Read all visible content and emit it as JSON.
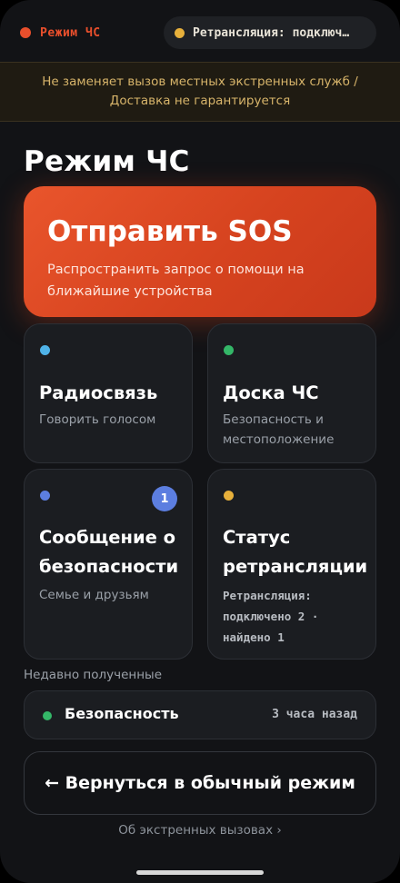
{
  "status": {
    "mode_label": "Режим ЧС",
    "relay_label": "Ретрансляция: подключ…"
  },
  "banner": {
    "text": "Не заменяет вызов местных экстренных служб / Доставка не гарантируется"
  },
  "page": {
    "title": "Режим ЧС"
  },
  "sos": {
    "title": "Отправить SOS",
    "subtitle": "Распространить запрос о помощи на ближайшие устройства"
  },
  "tiles": [
    {
      "title": "Радиосвязь",
      "subtitle": "Говорить голосом",
      "dot_color": "#4fb3e8"
    },
    {
      "title": "Доска ЧС",
      "subtitle": "Безопасность и местоположение",
      "dot_color": "#34b768"
    },
    {
      "title": "Сообщение о безопасности",
      "subtitle": "Семье и друзьям",
      "dot_color": "#5c7ee0",
      "badge": "1"
    },
    {
      "title": "Статус ретрансляции",
      "subtitle": "Ретрансляция: подключено 2 · найдено 1",
      "dot_color": "#e7b03b"
    }
  ],
  "recent": {
    "label": "Недавно полученные",
    "items": [
      {
        "title": "Безопасность",
        "time": "3 часа назад"
      }
    ]
  },
  "back_button": {
    "label": "← Вернуться в обычный режим"
  },
  "footer": {
    "link": "Об экстренных вызовах ›"
  },
  "colors": {
    "accent": "#e9552c",
    "warning_text": "#d7b46a",
    "background": "#121316"
  }
}
